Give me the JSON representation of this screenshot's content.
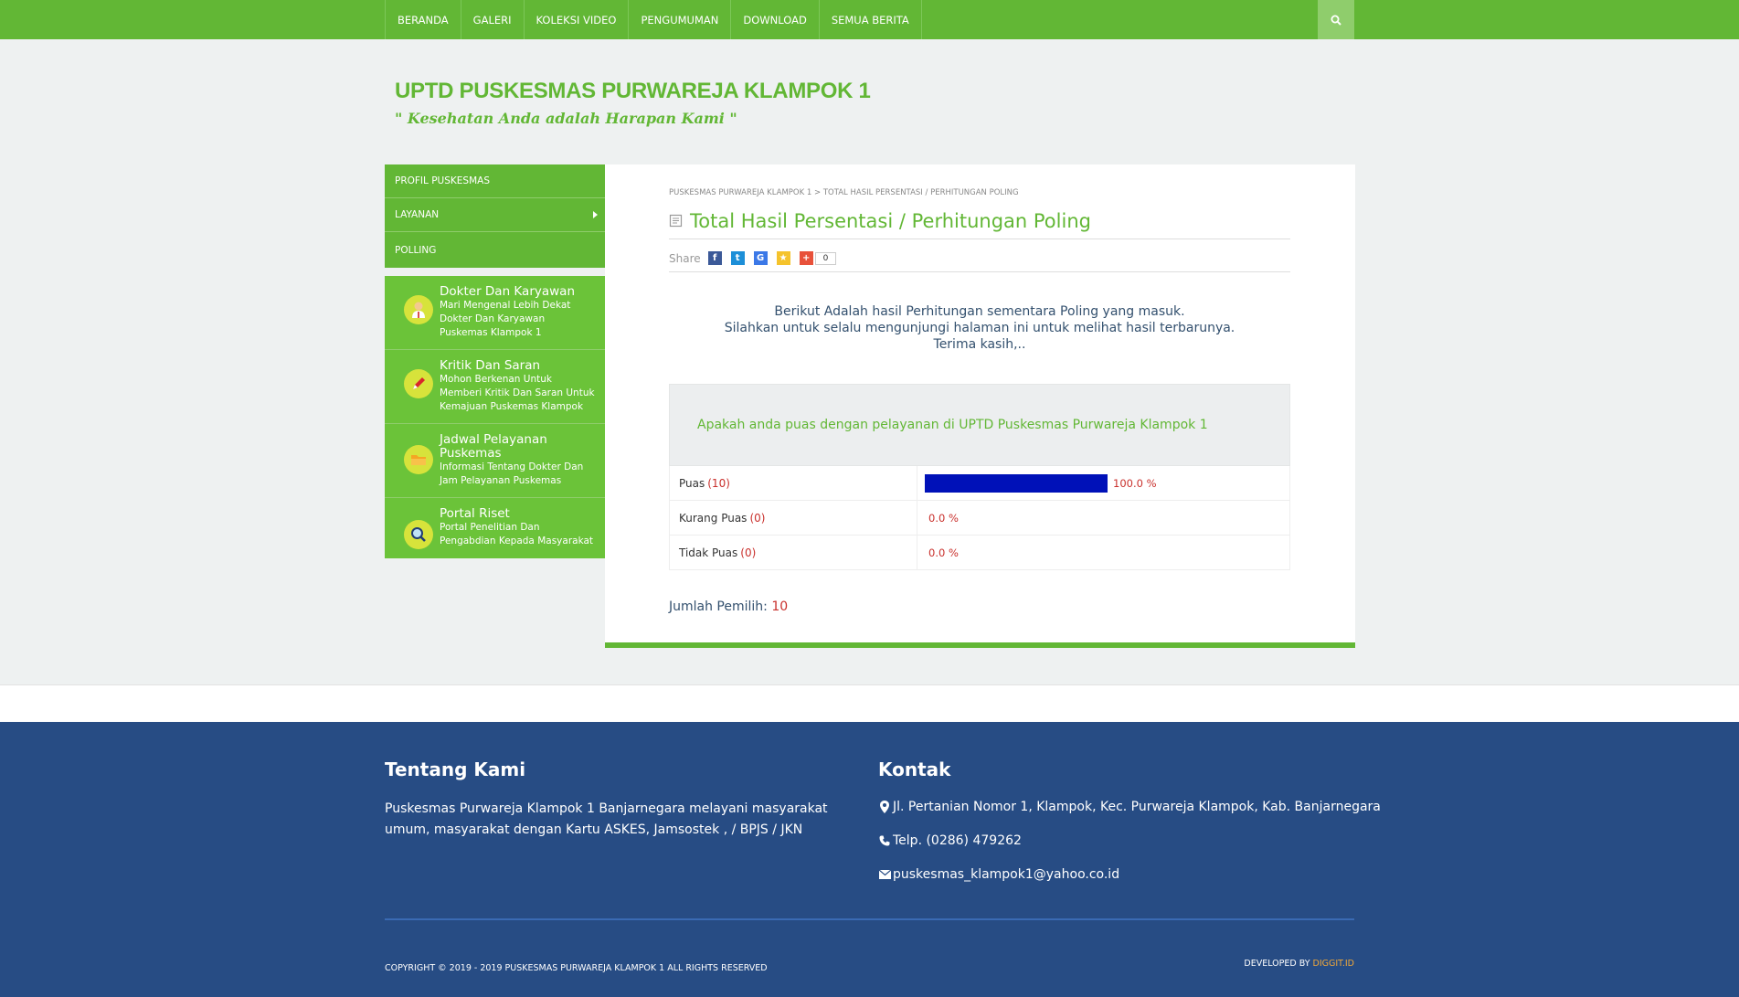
{
  "nav": {
    "items": [
      "BERANDA",
      "GALERI",
      "KOLEKSI VIDEO",
      "PENGUMUMAN",
      "DOWNLOAD",
      "SEMUA BERITA"
    ],
    "search_icon": "search-icon"
  },
  "header": {
    "title": "UPTD PUSKESMAS PURWAREJA KLAMPOK 1",
    "tagline": "\" Kesehatan Anda adalah Harapan Kami \""
  },
  "sidebar": {
    "menu": [
      {
        "label": "PROFIL PUSKESMAS"
      },
      {
        "label": "LAYANAN"
      },
      {
        "label": "POLLING"
      }
    ],
    "cards": [
      {
        "title": "Dokter Dan Karyawan",
        "desc": "Mari Mengenal Lebih Dekat Dokter Dan Karyawan Puskemas Klampok 1",
        "icon": "doctor-icon"
      },
      {
        "title": "Kritik Dan Saran",
        "desc": "Mohon Berkenan Untuk Memberi Kritik Dan Saran Untuk Kemajuan Puskemas Klampok",
        "icon": "pencil-icon"
      },
      {
        "title": "Jadwal Pelayanan Puskemas",
        "desc": "Informasi Tentang Dokter Dan Jam Pelayanan Puskemas",
        "icon": "folder-icon"
      },
      {
        "title": "Portal Riset",
        "desc": "Portal Penelitian Dan Pengabdian Kepada Masyarakat",
        "icon": "magnifier-icon"
      }
    ]
  },
  "main": {
    "breadcrumb": "PUSKESMAS PURWAREJA KLAMPOK 1 > TOTAL HASIL PERSENTASI / PERHITUNGAN POLING",
    "title": "Total Hasil Persentasi / Perhitungan Poling",
    "share_label": "Share",
    "share_count": "0",
    "intro": [
      "Berikut Adalah hasil Perhitungan sementara Poling yang masuk.",
      "Silahkan untuk selalu mengunjungi halaman ini untuk melihat hasil terbarunya.",
      "Terima kasih,.."
    ],
    "poll": {
      "question": "Apakah anda puas dengan pelayanan di UPTD Puskesmas Purwareja Klampok 1",
      "rows": [
        {
          "label": "Puas",
          "count": "(10)",
          "percent": "100.0 %",
          "fraction": 1.0
        },
        {
          "label": "Kurang Puas",
          "count": "(0)",
          "percent": "0.0 %",
          "fraction": 0.0
        },
        {
          "label": "Tidak Puas",
          "count": "(0)",
          "percent": "0.0 %",
          "fraction": 0.0
        }
      ],
      "bar_color": "#0011b8"
    },
    "voters_label": "Jumlah Pemilih:",
    "voters_count": "10"
  },
  "footer": {
    "about_title": "Tentang Kami",
    "about_text": "Puskesmas Purwareja Klampok 1 Banjarnegara melayani masyarakat umum, masyarakat dengan Kartu ASKES, Jamsostek , / BPJS / JKN",
    "contact_title": "Kontak",
    "address": "Jl. Pertanian Nomor 1, Klampok, Kec. Purwareja Klampok, Kab. Banjarnegara",
    "phone": "Telp. (0286) 479262",
    "email": "puskesmas_klampok1@yahoo.co.id",
    "copyright": "COPYRIGHT © 2019 - 2019 PUSKESMAS PURWAREJA KLAMPOK 1 ALL RIGHTS RESERVED",
    "developed_by": "DEVELOPED BY",
    "developer": "DIGGIT.ID"
  },
  "colors": {
    "brand_green": "#62b735",
    "footer_blue": "#274c84",
    "accent_red": "#c9302c"
  }
}
